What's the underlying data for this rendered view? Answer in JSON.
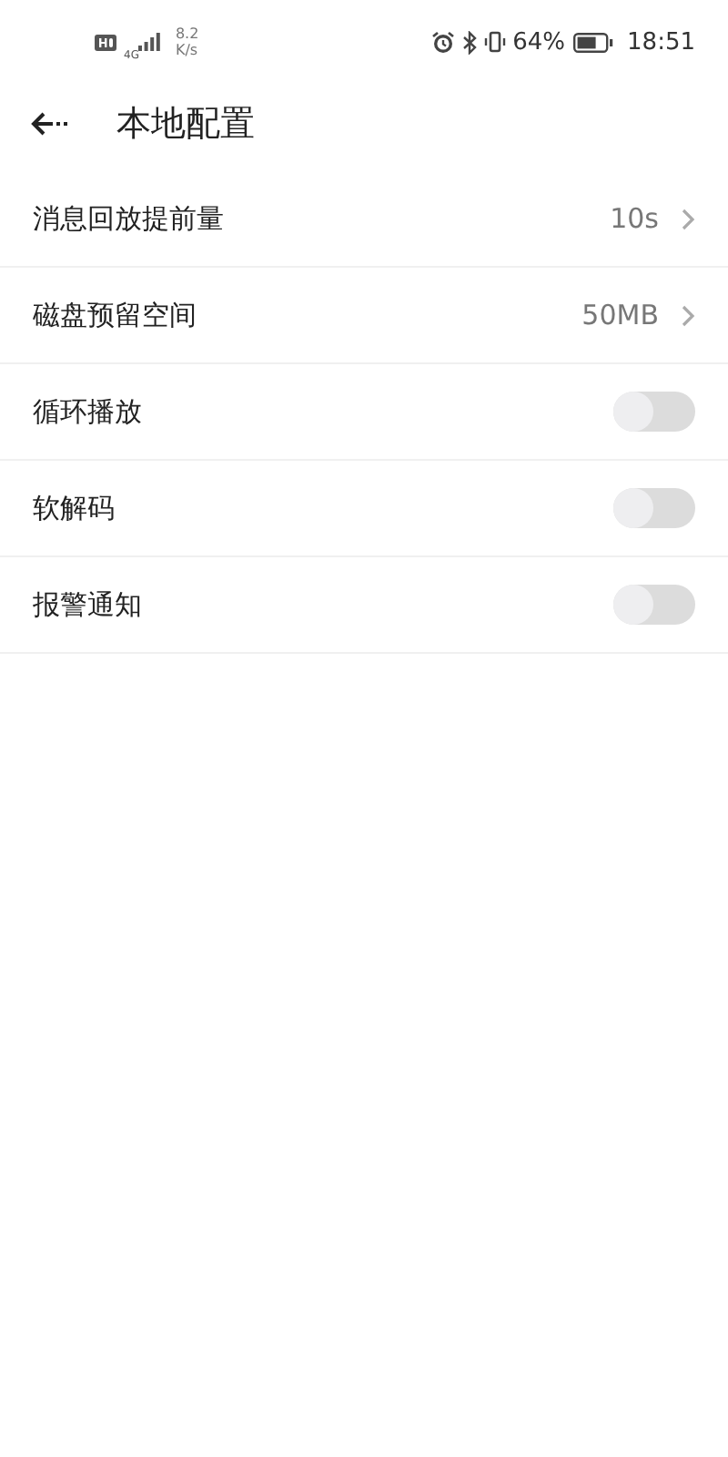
{
  "status_bar": {
    "network": "4G",
    "speed": "8.2",
    "speed_unit": "K/s",
    "battery": "64%",
    "time": "18:51"
  },
  "header": {
    "title": "本地配置"
  },
  "settings": [
    {
      "kind": "value",
      "label": "消息回放提前量",
      "value": "10s"
    },
    {
      "kind": "value",
      "label": "磁盘预留空间",
      "value": "50MB"
    },
    {
      "kind": "switch",
      "label": "循环播放",
      "on": false
    },
    {
      "kind": "switch",
      "label": "软解码",
      "on": false
    },
    {
      "kind": "switch",
      "label": "报警通知",
      "on": false
    }
  ]
}
